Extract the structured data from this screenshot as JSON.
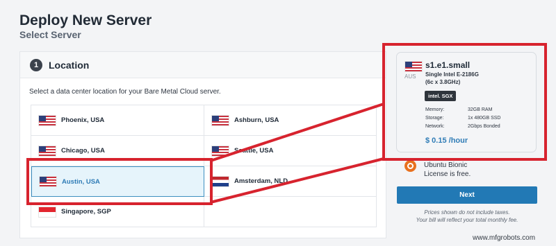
{
  "header": {
    "title": "Deploy New Server",
    "subtitle": "Select Server"
  },
  "location": {
    "step": "1",
    "title": "Location",
    "description": "Select a data center location for your Bare Metal Cloud server.",
    "items": [
      {
        "label": "Phoenix, USA",
        "flag": "usa"
      },
      {
        "label": "Ashburn, USA",
        "flag": "usa"
      },
      {
        "label": "Chicago, USA",
        "flag": "usa"
      },
      {
        "label": "Seattle, USA",
        "flag": "usa"
      },
      {
        "label": "Austin, USA",
        "flag": "usa",
        "selected": true
      },
      {
        "label": "Amsterdam, NLD",
        "flag": "nld"
      },
      {
        "label": "Singapore, SGP",
        "flag": "sgp"
      }
    ]
  },
  "plan": {
    "region": "AUS",
    "name": "s1.e1.small",
    "cpu": "Single Intel E-2186G",
    "cores": "(6c x 3.8GHz)",
    "badge": "intel. SGX",
    "specs": [
      {
        "label": "Memory:",
        "value": "32GB RAM"
      },
      {
        "label": "Storage:",
        "value": "1x 480GB SSD"
      },
      {
        "label": "Network:",
        "value": "2Gbps Bonded"
      }
    ],
    "price": "$ 0.15 /hour"
  },
  "os": {
    "name": "Ubuntu Bionic",
    "license": "License is free."
  },
  "actions": {
    "next_label": "Next",
    "note_1": "Prices shown do not include taxes.",
    "note_2": "Your bill will reflect your total monthly fee."
  },
  "colors": {
    "accent": "#2279b5",
    "highlight": "#d7232e",
    "selected_bg": "#e6f4fb"
  },
  "watermark": "www.mfgrobots.com"
}
